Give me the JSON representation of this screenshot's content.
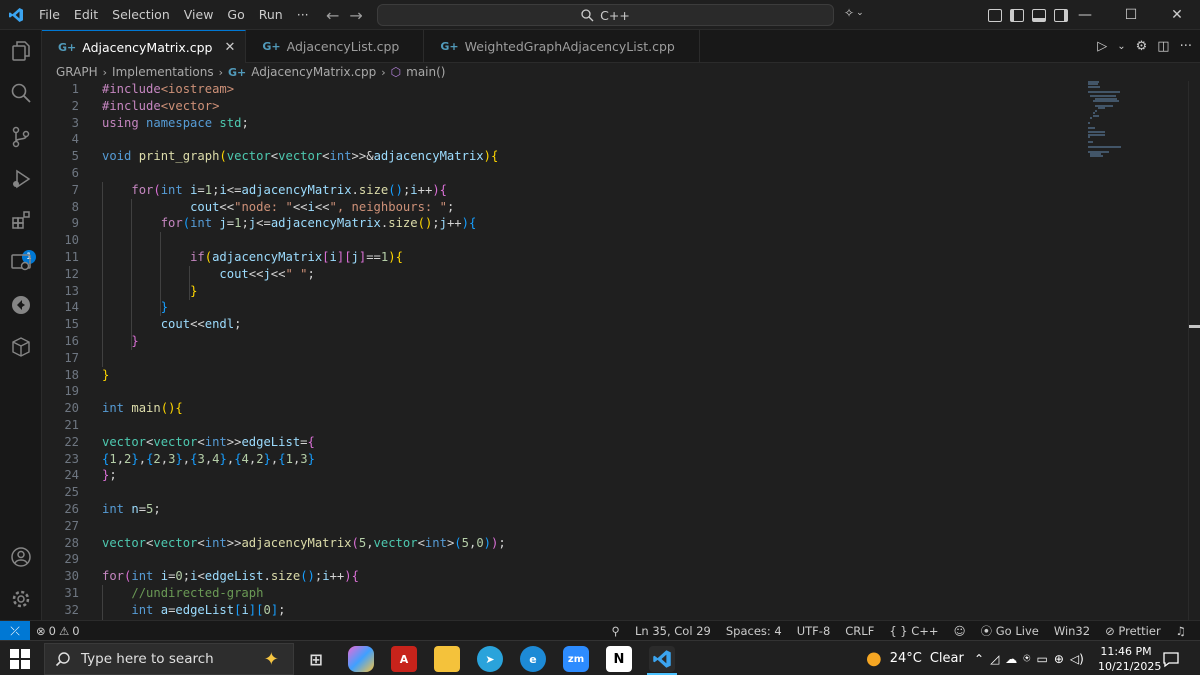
{
  "titlebar": {
    "menu": [
      "File",
      "Edit",
      "Selection",
      "View",
      "Go",
      "Run",
      "···"
    ],
    "search_text": "C++"
  },
  "tabs": [
    {
      "label": "AdjacencyMatrix.cpp",
      "icon": "cpp-file-icon",
      "active": true
    },
    {
      "label": "AdjacencyList.cpp",
      "icon": "cpp-file-icon",
      "active": false
    },
    {
      "label": "WeightedGraphAdjacencyList.cpp",
      "icon": "cpp-file-icon",
      "active": false
    }
  ],
  "breadcrumb": {
    "folder1": "GRAPH",
    "folder2": "Implementations",
    "file": "AdjacencyMatrix.cpp",
    "symbol": "main()"
  },
  "activity_badge": "1",
  "code": {
    "lines": [
      [
        [
          "k1",
          "#include"
        ],
        [
          "st",
          "<iostream>"
        ]
      ],
      [
        [
          "k1",
          "#include"
        ],
        [
          "st",
          "<vector>"
        ]
      ],
      [
        [
          "k1",
          "using"
        ],
        [
          "pn",
          " "
        ],
        [
          "k2",
          "namespace"
        ],
        [
          "pn",
          " "
        ],
        [
          "ty",
          "std"
        ],
        [
          "pn",
          ";"
        ]
      ],
      [],
      [
        [
          "k2",
          "void"
        ],
        [
          "pn",
          " "
        ],
        [
          "fn",
          "print_graph"
        ],
        [
          "b1",
          "("
        ],
        [
          "ty",
          "vector"
        ],
        [
          "pn",
          "<"
        ],
        [
          "ty",
          "vector"
        ],
        [
          "pn",
          "<"
        ],
        [
          "k2",
          "int"
        ],
        [
          "pn",
          ">>"
        ],
        [
          "pn",
          "&"
        ],
        [
          "vr",
          "adjacencyMatrix"
        ],
        [
          "b1",
          ")"
        ],
        [
          "b1",
          "{"
        ]
      ],
      [],
      [
        [
          "pn",
          "    "
        ],
        [
          "k1",
          "for"
        ],
        [
          "b2",
          "("
        ],
        [
          "k2",
          "int"
        ],
        [
          "pn",
          " "
        ],
        [
          "vr",
          "i"
        ],
        [
          "pn",
          "="
        ],
        [
          "nm",
          "1"
        ],
        [
          "pn",
          ";"
        ],
        [
          "vr",
          "i"
        ],
        [
          "pn",
          "<="
        ],
        [
          "vr",
          "adjacencyMatrix"
        ],
        [
          "pn",
          "."
        ],
        [
          "fn",
          "size"
        ],
        [
          "b3",
          "("
        ],
        [
          "b3",
          ")"
        ],
        [
          "pn",
          ";"
        ],
        [
          "vr",
          "i"
        ],
        [
          "pn",
          "++"
        ],
        [
          "b2",
          ")"
        ],
        [
          "b2",
          "{"
        ]
      ],
      [
        [
          "pn",
          "            "
        ],
        [
          "vr",
          "cout"
        ],
        [
          "pn",
          "<<"
        ],
        [
          "st",
          "\"node: \""
        ],
        [
          "pn",
          "<<"
        ],
        [
          "vr",
          "i"
        ],
        [
          "pn",
          "<<"
        ],
        [
          "st",
          "\", neighbours: \""
        ],
        [
          "pn",
          ";"
        ]
      ],
      [
        [
          "pn",
          "        "
        ],
        [
          "k1",
          "for"
        ],
        [
          "b3",
          "("
        ],
        [
          "k2",
          "int"
        ],
        [
          "pn",
          " "
        ],
        [
          "vr",
          "j"
        ],
        [
          "pn",
          "="
        ],
        [
          "nm",
          "1"
        ],
        [
          "pn",
          ";"
        ],
        [
          "vr",
          "j"
        ],
        [
          "pn",
          "<="
        ],
        [
          "vr",
          "adjacencyMatrix"
        ],
        [
          "pn",
          "."
        ],
        [
          "fn",
          "size"
        ],
        [
          "b1",
          "("
        ],
        [
          "b1",
          ")"
        ],
        [
          "pn",
          ";"
        ],
        [
          "vr",
          "j"
        ],
        [
          "pn",
          "++"
        ],
        [
          "b3",
          ")"
        ],
        [
          "b3",
          "{"
        ]
      ],
      [],
      [
        [
          "pn",
          "            "
        ],
        [
          "k1",
          "if"
        ],
        [
          "b1",
          "("
        ],
        [
          "vr",
          "adjacencyMatrix"
        ],
        [
          "b2",
          "["
        ],
        [
          "vr",
          "i"
        ],
        [
          "b2",
          "]"
        ],
        [
          "b2",
          "["
        ],
        [
          "vr",
          "j"
        ],
        [
          "b2",
          "]"
        ],
        [
          "pn",
          "=="
        ],
        [
          "nm",
          "1"
        ],
        [
          "b1",
          ")"
        ],
        [
          "b1",
          "{"
        ]
      ],
      [
        [
          "pn",
          "                "
        ],
        [
          "vr",
          "cout"
        ],
        [
          "pn",
          "<<"
        ],
        [
          "vr",
          "j"
        ],
        [
          "pn",
          "<<"
        ],
        [
          "st",
          "\" \""
        ],
        [
          "pn",
          ";"
        ]
      ],
      [
        [
          "pn",
          "            "
        ],
        [
          "b1",
          "}"
        ]
      ],
      [
        [
          "pn",
          "        "
        ],
        [
          "b3",
          "}"
        ]
      ],
      [
        [
          "pn",
          "        "
        ],
        [
          "vr",
          "cout"
        ],
        [
          "pn",
          "<<"
        ],
        [
          "vr",
          "endl"
        ],
        [
          "pn",
          ";"
        ]
      ],
      [
        [
          "pn",
          "    "
        ],
        [
          "b2",
          "}"
        ]
      ],
      [],
      [
        [
          "b1",
          "}"
        ]
      ],
      [],
      [
        [
          "k2",
          "int"
        ],
        [
          "pn",
          " "
        ],
        [
          "fn",
          "main"
        ],
        [
          "b1",
          "("
        ],
        [
          "b1",
          ")"
        ],
        [
          "b1",
          "{"
        ]
      ],
      [],
      [
        [
          "ty",
          "vector"
        ],
        [
          "pn",
          "<"
        ],
        [
          "ty",
          "vector"
        ],
        [
          "pn",
          "<"
        ],
        [
          "k2",
          "int"
        ],
        [
          "pn",
          ">>"
        ],
        [
          "vr",
          "edgeList"
        ],
        [
          "pn",
          "="
        ],
        [
          "b2",
          "{"
        ]
      ],
      [
        [
          "b3",
          "{"
        ],
        [
          "nm",
          "1"
        ],
        [
          "pn",
          ","
        ],
        [
          "nm",
          "2"
        ],
        [
          "b3",
          "}"
        ],
        [
          "pn",
          ","
        ],
        [
          "b3",
          "{"
        ],
        [
          "nm",
          "2"
        ],
        [
          "pn",
          ","
        ],
        [
          "nm",
          "3"
        ],
        [
          "b3",
          "}"
        ],
        [
          "pn",
          ","
        ],
        [
          "b3",
          "{"
        ],
        [
          "nm",
          "3"
        ],
        [
          "pn",
          ","
        ],
        [
          "nm",
          "4"
        ],
        [
          "b3",
          "}"
        ],
        [
          "pn",
          ","
        ],
        [
          "b3",
          "{"
        ],
        [
          "nm",
          "4"
        ],
        [
          "pn",
          ","
        ],
        [
          "nm",
          "2"
        ],
        [
          "b3",
          "}"
        ],
        [
          "pn",
          ","
        ],
        [
          "b3",
          "{"
        ],
        [
          "nm",
          "1"
        ],
        [
          "pn",
          ","
        ],
        [
          "nm",
          "3"
        ],
        [
          "b3",
          "}"
        ]
      ],
      [
        [
          "b2",
          "}"
        ],
        [
          "pn",
          ";"
        ]
      ],
      [],
      [
        [
          "k2",
          "int"
        ],
        [
          "pn",
          " "
        ],
        [
          "vr",
          "n"
        ],
        [
          "pn",
          "="
        ],
        [
          "nm",
          "5"
        ],
        [
          "pn",
          ";"
        ]
      ],
      [],
      [
        [
          "ty",
          "vector"
        ],
        [
          "pn",
          "<"
        ],
        [
          "ty",
          "vector"
        ],
        [
          "pn",
          "<"
        ],
        [
          "k2",
          "int"
        ],
        [
          "pn",
          ">>"
        ],
        [
          "fn",
          "adjacencyMatrix"
        ],
        [
          "b2",
          "("
        ],
        [
          "nm",
          "5"
        ],
        [
          "pn",
          ","
        ],
        [
          "ty",
          "vector"
        ],
        [
          "pn",
          "<"
        ],
        [
          "k2",
          "int"
        ],
        [
          "pn",
          ">"
        ],
        [
          "b3",
          "("
        ],
        [
          "nm",
          "5"
        ],
        [
          "pn",
          ","
        ],
        [
          "nm",
          "0"
        ],
        [
          "b3",
          ")"
        ],
        [
          "b2",
          ")"
        ],
        [
          "pn",
          ";"
        ]
      ],
      [],
      [
        [
          "k1",
          "for"
        ],
        [
          "b2",
          "("
        ],
        [
          "k2",
          "int"
        ],
        [
          "pn",
          " "
        ],
        [
          "vr",
          "i"
        ],
        [
          "pn",
          "="
        ],
        [
          "nm",
          "0"
        ],
        [
          "pn",
          ";"
        ],
        [
          "vr",
          "i"
        ],
        [
          "pn",
          "<"
        ],
        [
          "vr",
          "edgeList"
        ],
        [
          "pn",
          "."
        ],
        [
          "fn",
          "size"
        ],
        [
          "b3",
          "("
        ],
        [
          "b3",
          ")"
        ],
        [
          "pn",
          ";"
        ],
        [
          "vr",
          "i"
        ],
        [
          "pn",
          "++"
        ],
        [
          "b2",
          ")"
        ],
        [
          "b2",
          "{"
        ]
      ],
      [
        [
          "pn",
          "    "
        ],
        [
          "cm",
          "//undirected-graph"
        ]
      ],
      [
        [
          "pn",
          "    "
        ],
        [
          "k2",
          "int"
        ],
        [
          "pn",
          " "
        ],
        [
          "vr",
          "a"
        ],
        [
          "pn",
          "="
        ],
        [
          "vr",
          "edgeList"
        ],
        [
          "b3",
          "["
        ],
        [
          "vr",
          "i"
        ],
        [
          "b3",
          "]"
        ],
        [
          "b3",
          "["
        ],
        [
          "nm",
          "0"
        ],
        [
          "b3",
          "]"
        ],
        [
          "pn",
          ";"
        ]
      ]
    ]
  },
  "statusbar": {
    "errors": "0",
    "warnings": "0",
    "position": "Ln 35, Col 29",
    "spaces": "Spaces: 4",
    "encoding": "UTF-8",
    "eol": "CRLF",
    "language": "C++",
    "go_live": "Go Live",
    "platform": "Win32",
    "prettier": "Prettier"
  },
  "taskbar": {
    "search_placeholder": "Type here to search",
    "temperature": "24°C",
    "weather": "Clear",
    "time": "11:46 PM",
    "date": "10/21/2025",
    "zoom_label": "zm"
  },
  "colors": {
    "accent": "#0078d4",
    "editor_bg": "#1f1f1f",
    "keyword_control": "#c586c0",
    "keyword": "#569cd6",
    "type": "#4ec9b0",
    "function": "#dcdcaa",
    "variable": "#9cdcfe",
    "string": "#ce9178"
  }
}
